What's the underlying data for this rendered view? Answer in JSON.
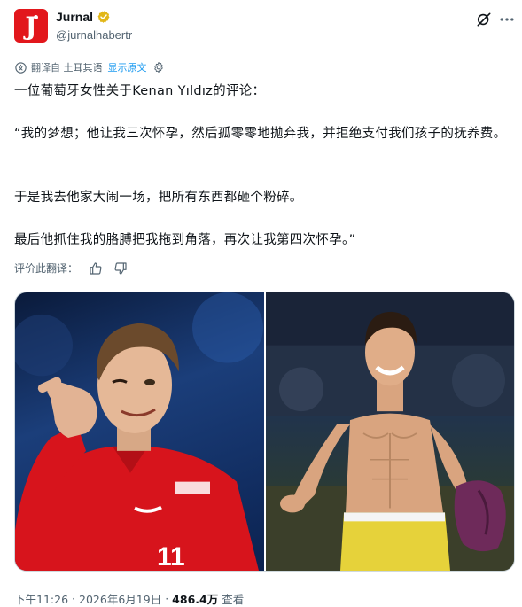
{
  "author": {
    "display_name": "Jurnal",
    "handle": "@jurnalhabertr",
    "avatar_letter": "J",
    "avatar_color": "#e2171c",
    "verified_badge_color": "#e2b719"
  },
  "translation": {
    "label": "翻译自 土耳其语",
    "show_original": "显示原文"
  },
  "tweet": {
    "line1": "一位葡萄牙女性关于Kenan Yıldız的评论：",
    "line2": "“我的梦想；他让我三次怀孕，然后孤零零地抛弃我，并拒绝支付我们孩子的抚养费。",
    "line3": "于是我去他家大闹一场，把所有东西都砸个粉碎。",
    "line4": "最后他抓住我的胳膊把我拖到角落，再次让我第四次怀孕。”"
  },
  "rate": {
    "label": "评价此翻译："
  },
  "footer": {
    "time": "下午11:26",
    "separator": "·",
    "date": "2026年6月19日",
    "views": "486.4万",
    "views_label": "查看"
  },
  "icons": {
    "grok": "grok-icon",
    "more": "more-icon",
    "translate": "translate-icon",
    "settings": "settings-icon",
    "thumb_up": "thumb-up-icon",
    "thumb_down": "thumb-down-icon"
  },
  "colors": {
    "link": "#1d9bf0",
    "secondary_text": "#536471",
    "primary_text": "#0f1419"
  }
}
